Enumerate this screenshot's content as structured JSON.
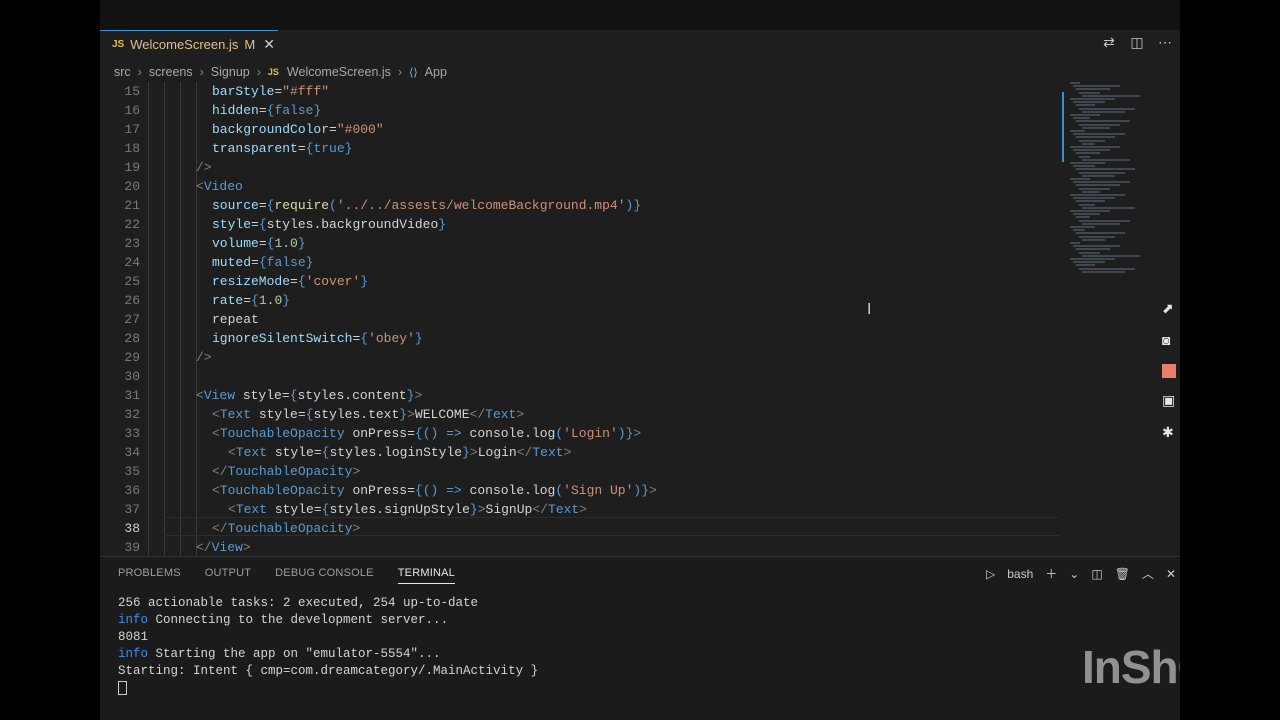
{
  "tab": {
    "lang_badge": "JS",
    "filename": "WelcomeScreen.js",
    "modified": "M",
    "close": "✕"
  },
  "breadcrumb": [
    "src",
    "screens",
    "Signup",
    "WelcomeScreen.js",
    "App"
  ],
  "editor": {
    "lines": [
      {
        "n": "15",
        "code": "barStyle=\"#fff\""
      },
      {
        "n": "16",
        "code": "hidden={false}"
      },
      {
        "n": "17",
        "code": "backgroundColor=\"#000\""
      },
      {
        "n": "18",
        "code": "transparent={true}"
      },
      {
        "n": "19",
        "code": "/>"
      },
      {
        "n": "20",
        "code": "<Video"
      },
      {
        "n": "21",
        "code": "source={require('../../assests/welcomeBackground.mp4')}"
      },
      {
        "n": "22",
        "code": "style={styles.backgroundVideo}"
      },
      {
        "n": "23",
        "code": "volume={1.0}"
      },
      {
        "n": "24",
        "code": "muted={false}"
      },
      {
        "n": "25",
        "code": "resizeMode={'cover'}"
      },
      {
        "n": "26",
        "code": "rate={1.0}"
      },
      {
        "n": "27",
        "code": "repeat"
      },
      {
        "n": "28",
        "code": "ignoreSilentSwitch={'obey'}"
      },
      {
        "n": "29",
        "code": "/>"
      },
      {
        "n": "30",
        "code": ""
      },
      {
        "n": "31",
        "code": "<View style={styles.content}>"
      },
      {
        "n": "32",
        "code": "<Text style={styles.text}>WELCOME</Text>"
      },
      {
        "n": "33",
        "code": "<TouchableOpacity onPress={() => console.log('Login')}>"
      },
      {
        "n": "34",
        "code": "<Text style={styles.loginStyle}>Login</Text>"
      },
      {
        "n": "35",
        "code": "</TouchableOpacity>"
      },
      {
        "n": "36",
        "code": "<TouchableOpacity onPress={() => console.log('Sign Up')}>"
      },
      {
        "n": "37",
        "code": "<Text style={styles.signUpStyle}>SignUp</Text>"
      },
      {
        "n": "38",
        "code": "</TouchableOpacity>"
      },
      {
        "n": "39",
        "code": "</View>"
      }
    ]
  },
  "panel": {
    "tabs": [
      "PROBLEMS",
      "OUTPUT",
      "DEBUG CONSOLE",
      "TERMINAL"
    ],
    "active_tab": "TERMINAL",
    "shell": "bash",
    "terminal": [
      {
        "prefix": "",
        "text": "256 actionable tasks: 2 executed, 254 up-to-date"
      },
      {
        "prefix": "info",
        "text": " Connecting to the development server..."
      },
      {
        "prefix": "",
        "text": "8081"
      },
      {
        "prefix": "info",
        "text": " Starting the app on \"emulator-5554\"..."
      },
      {
        "prefix": "",
        "text": "Starting: Intent { cmp=com.dreamcategory/.MainActivity }"
      }
    ]
  },
  "watermark": "InShOt",
  "colors": {
    "accent": "#3c8fd6",
    "info": "#3b8eea",
    "string": "#ce9178",
    "tag": "#569cd6",
    "attr": "#9cdcfe"
  }
}
